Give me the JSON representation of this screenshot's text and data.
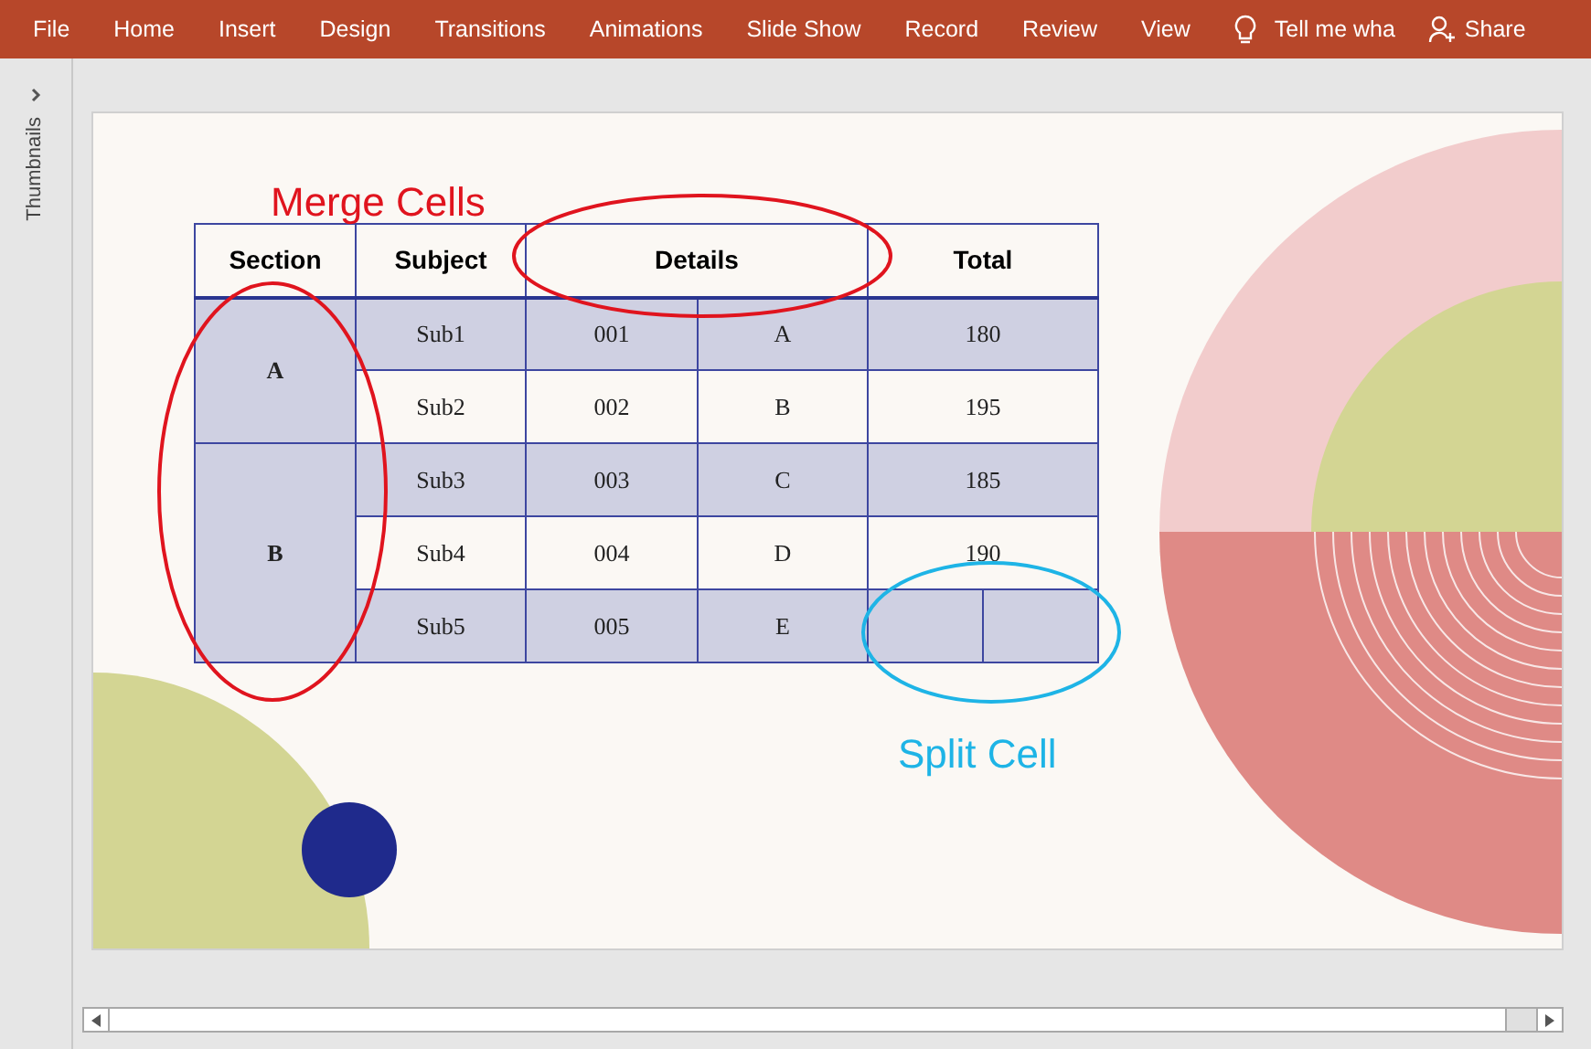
{
  "ribbon": {
    "tabs": [
      "File",
      "Home",
      "Insert",
      "Design",
      "Transitions",
      "Animations",
      "Slide Show",
      "Record",
      "Review",
      "View"
    ],
    "tell_me": "Tell me wha",
    "share": "Share"
  },
  "thumbnails_pane": {
    "label": "Thumbnails"
  },
  "slide": {
    "annotations": [
      {
        "kind": "merge",
        "text": "Merge Cells",
        "color": "#e0141e"
      },
      {
        "kind": "split",
        "text": "Split Cell",
        "color": "#1eb4e6"
      }
    ],
    "table": {
      "columns": [
        "Section",
        "Subject",
        "Details",
        "Total"
      ],
      "sections": [
        {
          "label": "A",
          "rows": [
            {
              "kind": "plain",
              "shaded": true,
              "subject": "Sub1",
              "code": "001",
              "letter": "A",
              "total": "180"
            },
            {
              "kind": "plain",
              "shaded": false,
              "subject": "Sub2",
              "code": "002",
              "letter": "B",
              "total": "195"
            }
          ]
        },
        {
          "label": "B",
          "rows": [
            {
              "kind": "plain",
              "shaded": true,
              "subject": "Sub3",
              "code": "003",
              "letter": "C",
              "total": "185"
            },
            {
              "kind": "plain",
              "shaded": false,
              "subject": "Sub4",
              "code": "004",
              "letter": "D",
              "total": "190"
            },
            {
              "kind": "split",
              "shaded": true,
              "subject": "Sub5",
              "code": "005",
              "letter": "E"
            }
          ]
        }
      ]
    }
  }
}
